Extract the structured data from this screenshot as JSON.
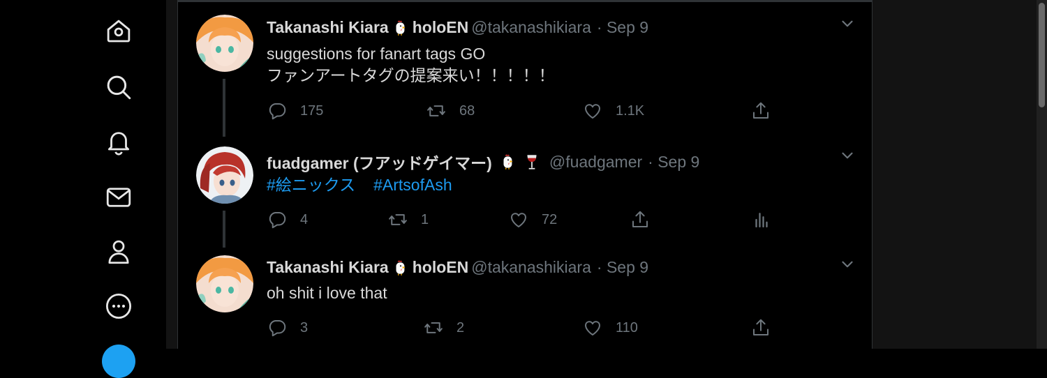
{
  "sidebar": {
    "items": [
      {
        "icon": "home-icon",
        "label": "Home"
      },
      {
        "icon": "search-icon",
        "label": "Explore"
      },
      {
        "icon": "bell-icon",
        "label": "Notifications"
      },
      {
        "icon": "mail-icon",
        "label": "Messages"
      },
      {
        "icon": "profile-icon",
        "label": "Profile"
      },
      {
        "icon": "more-icon",
        "label": "More"
      }
    ]
  },
  "tweets": [
    {
      "name": "Takanashi Kiara",
      "name_suffix": "holoEN",
      "emojis": [
        "chicken-emoji"
      ],
      "handle": "@takanashikiara",
      "date": "· Sep 9",
      "lines": [
        "suggestions for fanart tags GO",
        "ファンアートタグの提案来い！！！！！"
      ],
      "replies": "175",
      "retweets": "68",
      "likes": "1.1K"
    },
    {
      "name": "fuadgamer (フアッドゲイマー)",
      "emojis": [
        "chicken-emoji",
        "wine-glass-emoji"
      ],
      "handle": "@fuadgamer",
      "date": "· Sep 9",
      "hashtags": [
        "#絵ニックス",
        "#ArtsofAsh"
      ],
      "replies": "4",
      "retweets": "1",
      "likes": "72"
    },
    {
      "name": "Takanashi Kiara",
      "name_suffix": "holoEN",
      "emojis": [
        "chicken-emoji"
      ],
      "handle": "@takanashikiara",
      "date": "· Sep 9",
      "lines": [
        "oh shit i love that"
      ],
      "replies": "3",
      "retweets": "2",
      "likes": "110"
    }
  ],
  "colors": {
    "background": "#000000",
    "text": "#d9d9d9",
    "muted": "#6e767d",
    "link": "#1d9bf0",
    "border": "#2f3336"
  }
}
